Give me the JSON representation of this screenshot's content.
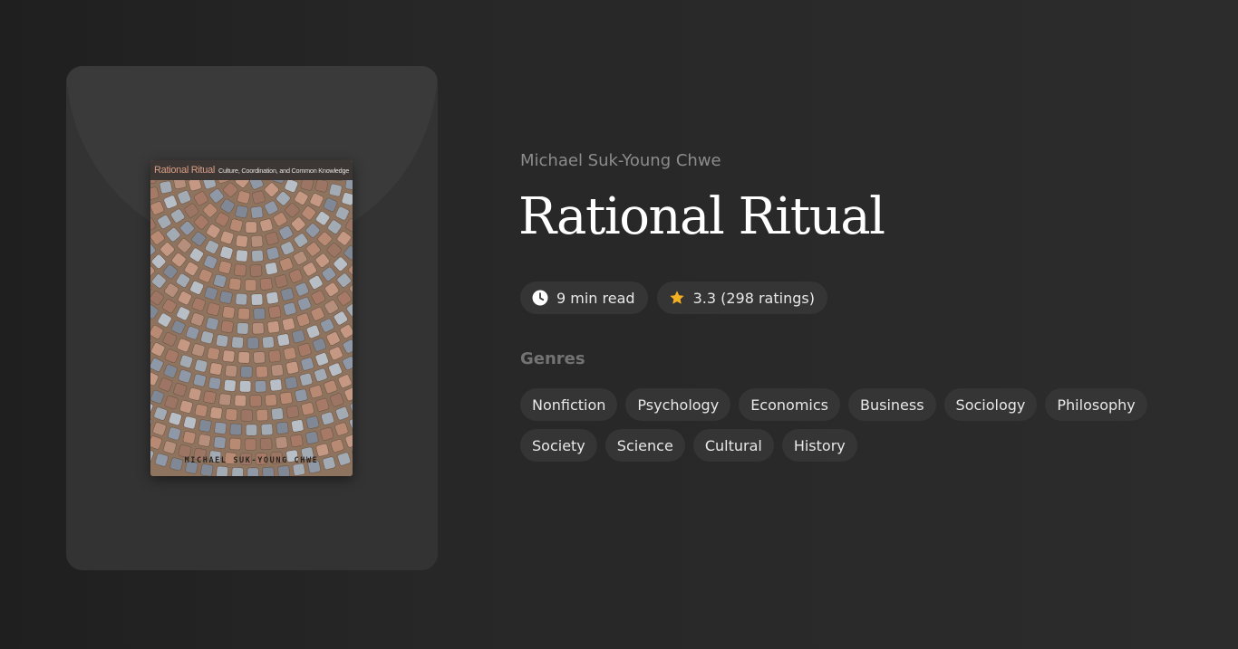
{
  "book": {
    "author": "Michael Suk-Young Chwe",
    "title": "Rational Ritual",
    "cover": {
      "title_main": "Rational Ritual",
      "title_sub": "Culture, Coordination, and Common Knowledge",
      "author": "MICHAEL SUK-YOUNG CHWE"
    }
  },
  "meta": {
    "read_time": "9 min read",
    "rating": "3.3 (298 ratings)",
    "read_icon": "clock-icon",
    "rating_icon": "star-icon",
    "star_color": "#f5b021"
  },
  "genres": {
    "label": "Genres",
    "items": [
      "Nonfiction",
      "Psychology",
      "Economics",
      "Business",
      "Sociology",
      "Philosophy",
      "Society",
      "Science",
      "Cultural",
      "History"
    ]
  }
}
